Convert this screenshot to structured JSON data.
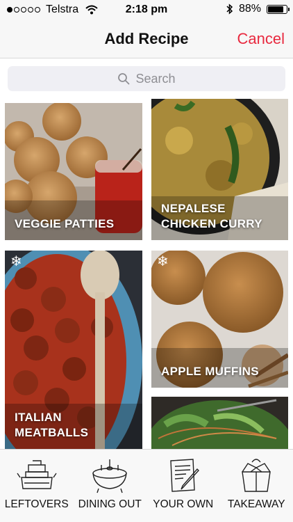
{
  "status": {
    "carrier": "Telstra",
    "time": "2:18 pm",
    "battery": "88%",
    "battery_level": 0.88
  },
  "nav": {
    "title": "Add Recipe",
    "cancel": "Cancel"
  },
  "search": {
    "placeholder": "Search"
  },
  "recipes": [
    {
      "name": "VEGGIE PATTIES",
      "frozen": false
    },
    {
      "name": "NEPALESE\nCHICKEN CURRY",
      "frozen": false
    },
    {
      "name": "ITALIAN\nMEATBALLS",
      "frozen": true
    },
    {
      "name": "APPLE MUFFINS",
      "frozen": true
    },
    {
      "name": "",
      "frozen": false
    }
  ],
  "tabs": [
    {
      "label": "LEFTOVERS",
      "icon": "leftovers-icon"
    },
    {
      "label": "DINING OUT",
      "icon": "dining-out-icon"
    },
    {
      "label": "YOUR OWN",
      "icon": "your-own-icon"
    },
    {
      "label": "TAKEAWAY",
      "icon": "takeaway-icon"
    }
  ],
  "colors": {
    "accent": "#e8293f"
  }
}
